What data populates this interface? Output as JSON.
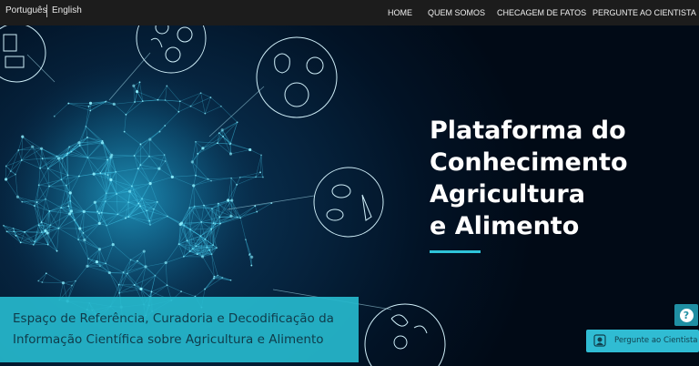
{
  "topbar": {
    "languages": [
      "Português",
      "English"
    ],
    "nav": [
      "HOME",
      "QUEM SOMOS",
      "CHECAGEM DE FATOS",
      "PERGUNTE AO CIENTISTA"
    ]
  },
  "hero": {
    "title_lines": [
      "Plataforma do",
      "Conhecimento",
      "Agricultura",
      "e Alimento"
    ],
    "tagline_lines": [
      "Espaço de Referência, Curadoria e Decodificação da",
      "Informação Científica sobre Agricultura e Alimento"
    ],
    "food_icon_circles": [
      "dairy-icon",
      "fruits-icon",
      "vegetables-icon",
      "meat-fish-icon",
      "grains-icon"
    ]
  },
  "help": {
    "help_icon": "question-icon",
    "ask_scientist_label": "Pergunte ao Cientista",
    "ask_icon": "scientist-icon"
  },
  "colors": {
    "accent": "#2ec4d9",
    "topbar": "#1c1c1c",
    "background": "#021326"
  }
}
